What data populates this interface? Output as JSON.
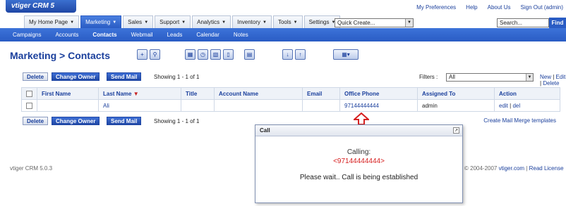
{
  "app": {
    "logo": "vtiger CRM 5"
  },
  "toplinks": [
    "My Preferences",
    "Help",
    "About Us",
    "Sign Out (admin)"
  ],
  "menu": [
    {
      "label": "My Home Page"
    },
    {
      "label": "Marketing"
    },
    {
      "label": "Sales"
    },
    {
      "label": "Support"
    },
    {
      "label": "Analytics"
    },
    {
      "label": "Inventory"
    },
    {
      "label": "Tools"
    },
    {
      "label": "Settings"
    }
  ],
  "quick_create": {
    "value": "Quick Create..."
  },
  "search": {
    "value": "Search...",
    "button": "Find"
  },
  "subnav": [
    "Campaigns",
    "Accounts",
    "Contacts",
    "Webmail",
    "Leads",
    "Calendar",
    "Notes"
  ],
  "page": {
    "title": "Marketing > Contacts"
  },
  "list": {
    "delete_label": "Delete",
    "change_owner_label": "Change Owner",
    "send_mail_label": "Send Mail",
    "showing": "Showing 1 - 1 of 1",
    "filters_label": "Filters :",
    "filter_value": "All",
    "new_link": "New",
    "edit_link": "Edit",
    "delete_link": "Delete",
    "merge_link": "Create Mail Merge templates",
    "columns": [
      "First Name",
      "Last Name",
      "Title",
      "Account Name",
      "Email",
      "Office Phone",
      "Assigned To",
      "Action"
    ],
    "rows": [
      {
        "first_name": "",
        "last_name": "Ali",
        "title": "",
        "account_name": "",
        "email": "",
        "office_phone": "97144444444",
        "assigned_to": "admin",
        "edit": "edit",
        "del": "del"
      }
    ]
  },
  "footer": {
    "left": "vtiger CRM 5.0.3",
    "right_prefix": "© 2004-2007",
    "right_link1": "vtiger.com",
    "right_link2": "Read License"
  },
  "popup": {
    "title": "Call",
    "calling": "Calling:",
    "number": "<97144444444>",
    "message": "Please wait.. Call is being established"
  },
  "colors": {
    "accent": "#2a5cc4",
    "link": "#1a3f9c",
    "alert": "#d62020"
  }
}
